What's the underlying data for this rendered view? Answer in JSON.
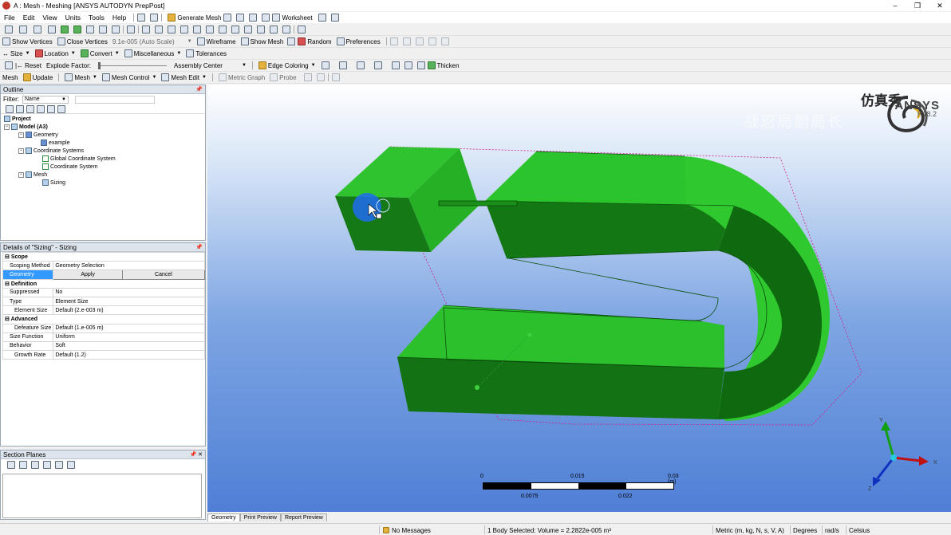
{
  "window": {
    "title": "A : Mesh - Meshing [ANSYS AUTODYN PrepPost]",
    "controls": [
      "–",
      "❐",
      "✕"
    ]
  },
  "menu": [
    "File",
    "Edit",
    "View",
    "Units",
    "Tools",
    "Help"
  ],
  "toolbar1": {
    "generate_mesh": "Generate Mesh",
    "worksheet": "Worksheet"
  },
  "toolbar2": {
    "show_vertices": "Show Vertices",
    "close_vertices": "Close Vertices",
    "auto_scale": "9.1e-005 (Auto Scale)",
    "wireframe": "Wireframe",
    "show_mesh": "Show Mesh",
    "random": "Random",
    "preferences": "Preferences"
  },
  "toolbar3": {
    "size": "Size",
    "location": "Location",
    "convert": "Convert",
    "miscellaneous": "Miscellaneous",
    "tolerances": "Tolerances"
  },
  "toolbar4": {
    "reset": "Reset",
    "explode_factor": "Explode Factor:",
    "assembly_center": "Assembly Center",
    "edge_coloring": "Edge Coloring",
    "thicken": "Thicken"
  },
  "toolbar5": {
    "mesh_label": "Mesh",
    "update": "Update",
    "mesh": "Mesh",
    "mesh_control": "Mesh Control",
    "mesh_edit": "Mesh Edit",
    "metric_graph": "Metric Graph",
    "probe": "Probe"
  },
  "outline": {
    "header": "Outline",
    "filter_label": "Filter:",
    "filter_value": "Name",
    "tree": {
      "project": "Project",
      "model": "Model (A3)",
      "geometry": "Geometry",
      "example": "example",
      "coordinate_systems": "Coordinate Systems",
      "global_cs": "Global Coordinate System",
      "cs": "Coordinate System",
      "mesh": "Mesh",
      "sizing": "Sizing"
    }
  },
  "details": {
    "header": "Details of \"Sizing\" - Sizing",
    "scope": "Scope",
    "scoping_method_label": "Scoping Method",
    "scoping_method_value": "Geometry Selection",
    "geometry_label": "Geometry",
    "apply": "Apply",
    "cancel": "Cancel",
    "definition": "Definition",
    "suppressed_label": "Suppressed",
    "suppressed_value": "No",
    "type_label": "Type",
    "type_value": "Element Size",
    "element_size_label": "Element Size",
    "element_size_value": "Default (2.e-003 m)",
    "advanced": "Advanced",
    "defeature_label": "Defeature Size",
    "defeature_value": "Default (1.e-005 m)",
    "size_function_label": "Size Function",
    "size_function_value": "Uniform",
    "behavior_label": "Behavior",
    "behavior_value": "Soft",
    "growth_rate_label": "Growth Rate",
    "growth_rate_value": "Default (1.2)"
  },
  "section_planes": {
    "header": "Section Planes"
  },
  "viewport": {
    "brand_cn": "仿真秀",
    "ansys": "ANSYS",
    "version": "R18.2",
    "watermark": "战忍局副局长",
    "scale": {
      "top_labels": [
        "0",
        "0.015",
        "0.03 (m)"
      ],
      "bottom_labels": [
        "0.0075",
        "0.022"
      ]
    },
    "triad": {
      "x": "X",
      "y": "Y",
      "z": "Z"
    },
    "colors": {
      "body": "#1f9e1f",
      "body_light": "#2ec42e",
      "body_dark": "#116611",
      "background_top": "#ffffff",
      "background_bottom": "#4f7fd6"
    }
  },
  "tabs": [
    "Geometry",
    "Print Preview",
    "Report Preview"
  ],
  "status": {
    "messages": "No Messages",
    "selection": "1 Body Selected: Volume = 2.2822e-005 m³",
    "units": "Metric (m, kg, N, s, V, A)",
    "angle": "Degrees",
    "rate": "rad/s",
    "temp": "Celsius"
  }
}
